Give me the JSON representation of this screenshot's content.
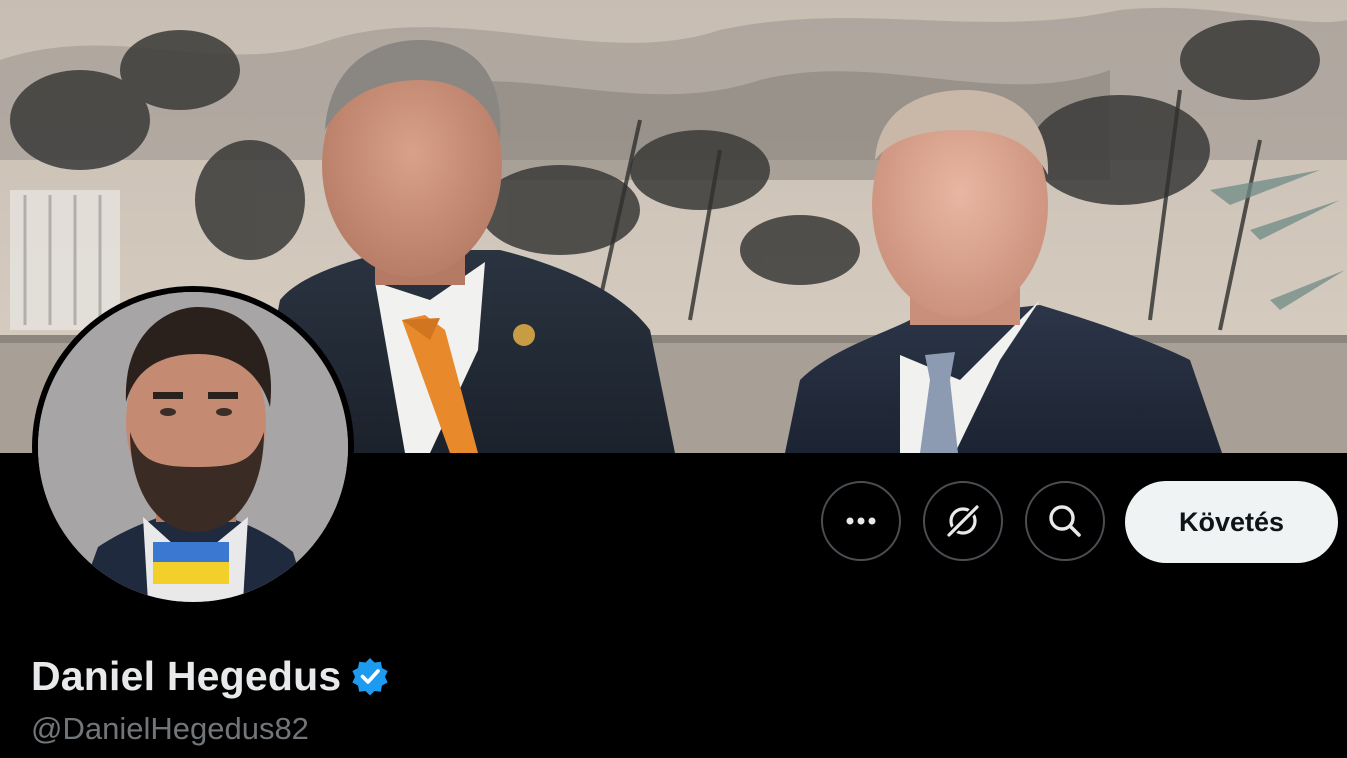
{
  "profile": {
    "display_name": "Daniel Hegedus",
    "handle": "@DanielHegedus82",
    "verified": true,
    "verified_badge_icon": "verified-badge-icon",
    "verified_color": "#1d9bf0"
  },
  "actions": {
    "more_icon": "more-dots-icon",
    "grok_icon": "grok-icon",
    "search_icon": "search-icon",
    "follow_label": "Követés"
  },
  "banner": {
    "description_icon": "banner-photo"
  },
  "colors": {
    "background": "#000000",
    "name_text": "#e7e9ea",
    "handle_text": "#71767b",
    "button_border": "#4a4f54",
    "follow_bg": "#eff3f4",
    "follow_text": "#0f1419"
  }
}
